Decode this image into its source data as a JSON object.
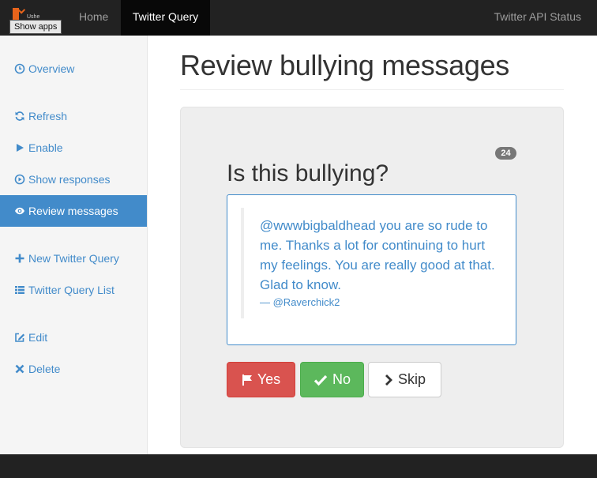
{
  "navbar": {
    "tooltip": "Show apps",
    "brand_text": "Ushe",
    "home": "Home",
    "active": "Twitter Query",
    "right": "Twitter API Status"
  },
  "sidebar": {
    "items": [
      {
        "label": "Overview",
        "icon": "clock-icon"
      },
      {
        "label": "Refresh",
        "icon": "refresh-icon"
      },
      {
        "label": "Enable",
        "icon": "play-icon"
      },
      {
        "label": "Show responses",
        "icon": "play-circle-icon"
      },
      {
        "label": "Review messages",
        "icon": "eye-icon",
        "active": true
      },
      {
        "label": "New Twitter Query",
        "icon": "plus-icon"
      },
      {
        "label": "Twitter Query List",
        "icon": "list-icon"
      },
      {
        "label": "Edit",
        "icon": "edit-icon"
      },
      {
        "label": "Delete",
        "icon": "remove-icon"
      }
    ]
  },
  "main": {
    "title": "Review bullying messages",
    "count_badge": "24",
    "question": "Is this bullying?",
    "message": {
      "text": "@wwwbigbaldhead you are so rude to me. Thanks a lot for continuing to hurt my feelings. You are really good at that. Glad to know.",
      "author": "— @Raverchick2"
    },
    "buttons": {
      "yes": "Yes",
      "no": "No",
      "skip": "Skip"
    }
  },
  "colors": {
    "accent": "#428bca",
    "danger": "#d9534f",
    "success": "#5cb85c",
    "navbar": "#222222"
  }
}
